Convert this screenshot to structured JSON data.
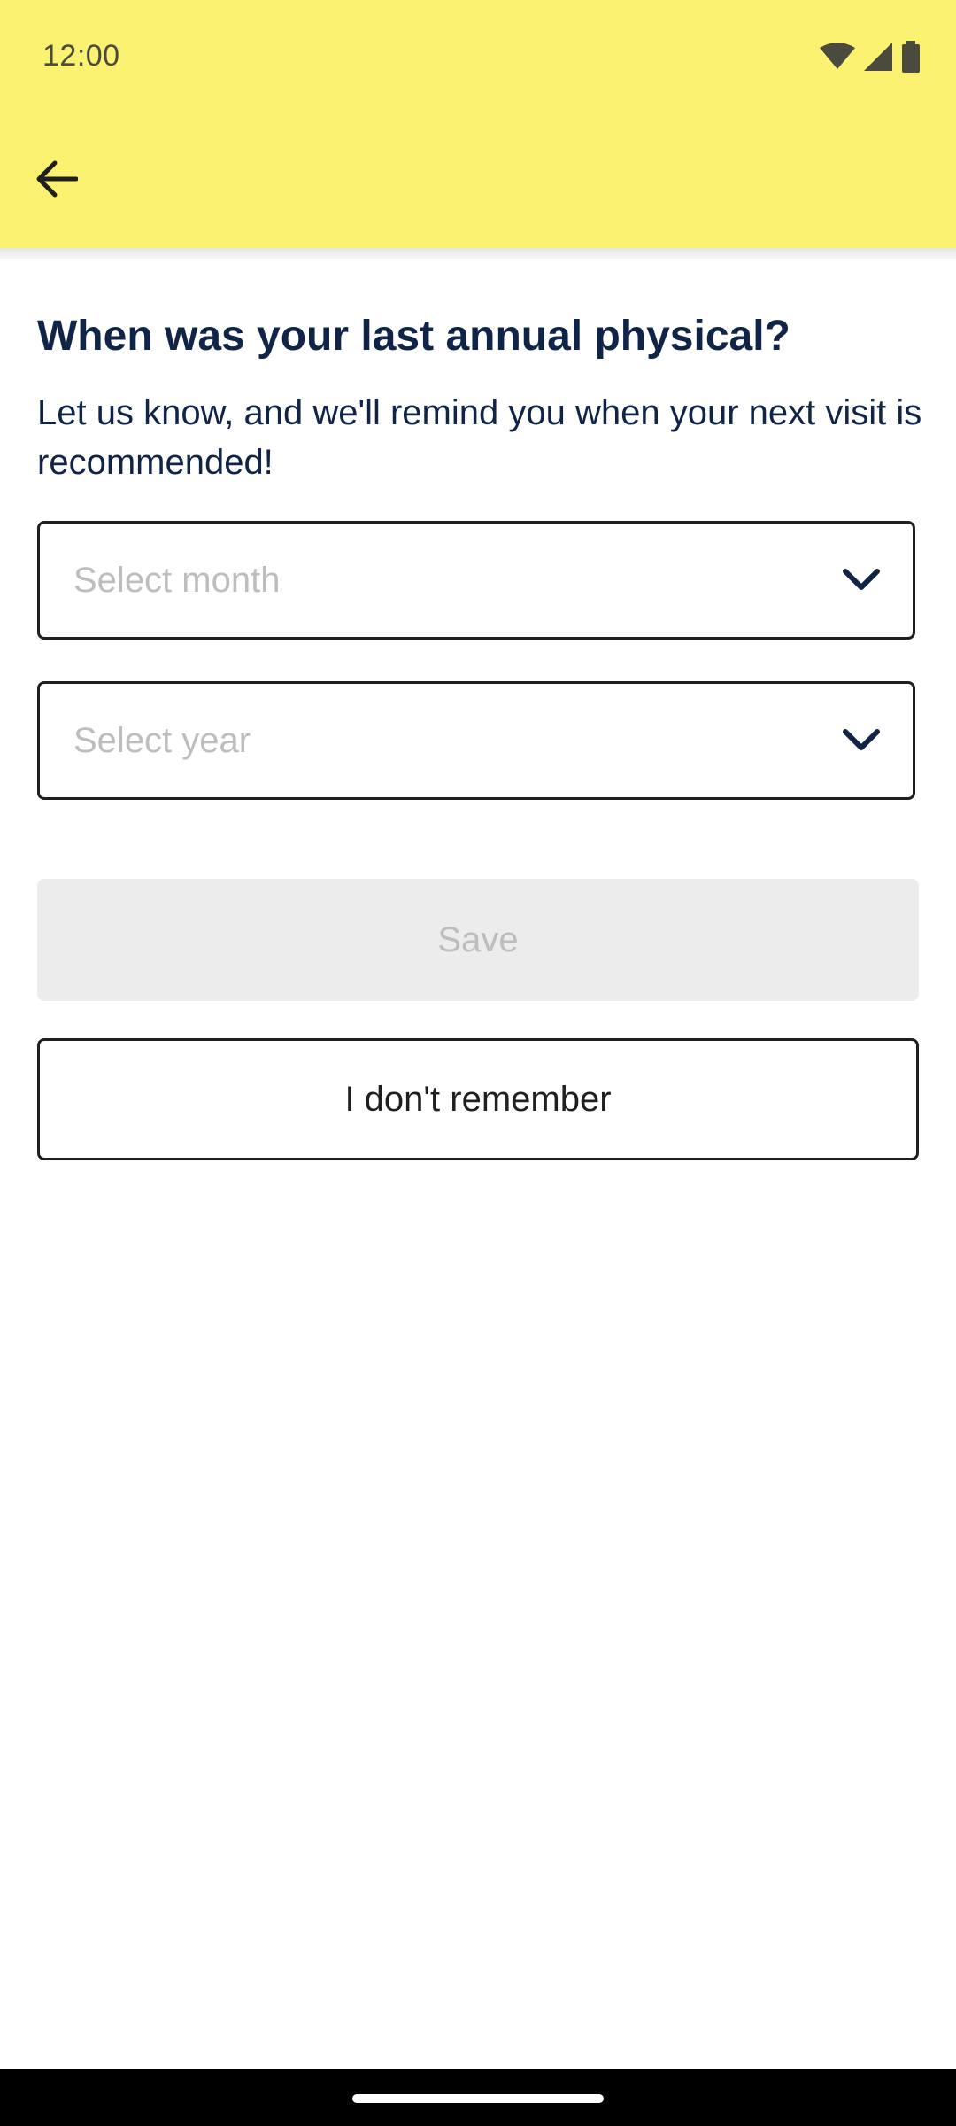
{
  "status_bar": {
    "time": "12:00",
    "icons": [
      "wifi-icon",
      "cellular-signal-icon",
      "battery-icon"
    ]
  },
  "app_bar": {
    "back_icon": "arrow-left-icon"
  },
  "content": {
    "title": "When was your last annual physical?",
    "subtitle": "Let us know, and we'll remind you when your next visit is recommended!",
    "month_select": {
      "placeholder": "Select month",
      "icon": "chevron-down-icon"
    },
    "year_select": {
      "placeholder": "Select year",
      "icon": "chevron-down-icon"
    },
    "save_label": "Save",
    "dont_remember_label": "I don't remember"
  },
  "colors": {
    "header_background": "#fbf271",
    "text_primary": "#0f2446",
    "disabled_background": "#ececec",
    "disabled_text": "#bdbdbd"
  }
}
